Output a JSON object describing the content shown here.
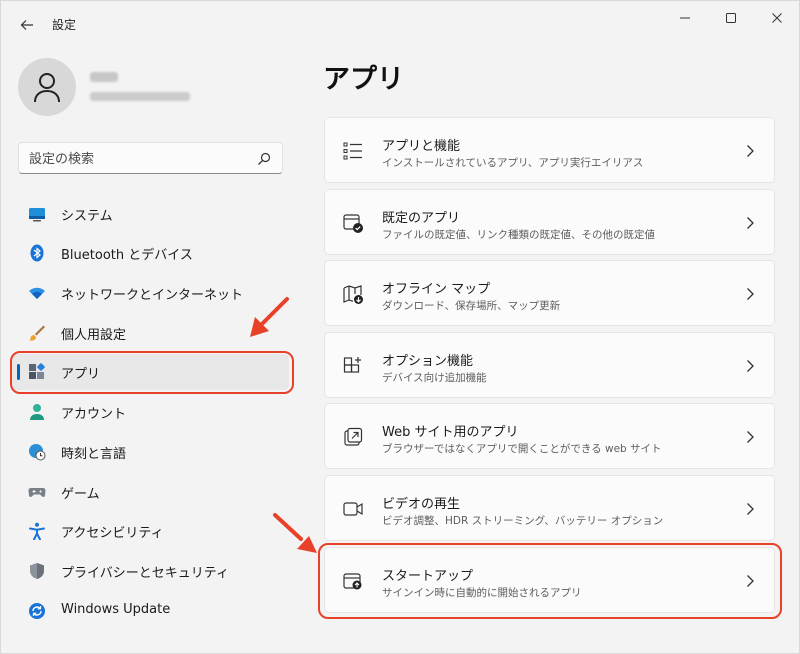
{
  "titlebar": {
    "app_title": "設定"
  },
  "search": {
    "placeholder": "設定の検索"
  },
  "sidebar": {
    "items": [
      {
        "label": "システム",
        "icon": "monitor-icon"
      },
      {
        "label": "Bluetooth とデバイス",
        "icon": "bluetooth-icon"
      },
      {
        "label": "ネットワークとインターネット",
        "icon": "wifi-icon"
      },
      {
        "label": "個人用設定",
        "icon": "brush-icon"
      },
      {
        "label": "アプリ",
        "icon": "apps-icon",
        "selected": true
      },
      {
        "label": "アカウント",
        "icon": "person-icon"
      },
      {
        "label": "時刻と言語",
        "icon": "globe-clock-icon"
      },
      {
        "label": "ゲーム",
        "icon": "gamepad-icon"
      },
      {
        "label": "アクセシビリティ",
        "icon": "accessibility-icon"
      },
      {
        "label": "プライバシーとセキュリティ",
        "icon": "shield-icon"
      },
      {
        "label": "Windows Update",
        "icon": "update-icon"
      }
    ]
  },
  "main": {
    "title": "アプリ",
    "cards": [
      {
        "title": "アプリと機能",
        "subtitle": "インストールされているアプリ、アプリ実行エイリアス",
        "icon": "app-list-icon"
      },
      {
        "title": "既定のアプリ",
        "subtitle": "ファイルの既定値、リンク種類の既定値、その他の既定値",
        "icon": "default-app-icon"
      },
      {
        "title": "オフライン マップ",
        "subtitle": "ダウンロード、保存場所、マップ更新",
        "icon": "offline-map-icon"
      },
      {
        "title": "オプション機能",
        "subtitle": "デバイス向け追加機能",
        "icon": "optional-features-icon"
      },
      {
        "title": "Web サイト用のアプリ",
        "subtitle": "ブラウザーではなくアプリで開くことができる web サイト",
        "icon": "open-external-icon"
      },
      {
        "title": "ビデオの再生",
        "subtitle": "ビデオ調整、HDR ストリーミング、バッテリー オプション",
        "icon": "video-icon"
      },
      {
        "title": "スタートアップ",
        "subtitle": "サインイン時に自動的に開始されるアプリ",
        "icon": "startup-icon"
      }
    ]
  },
  "colors": {
    "accent": "#0067c0",
    "annotation": "#e8412a",
    "background": "#f3f3f3",
    "card": "#fbfbfb"
  }
}
